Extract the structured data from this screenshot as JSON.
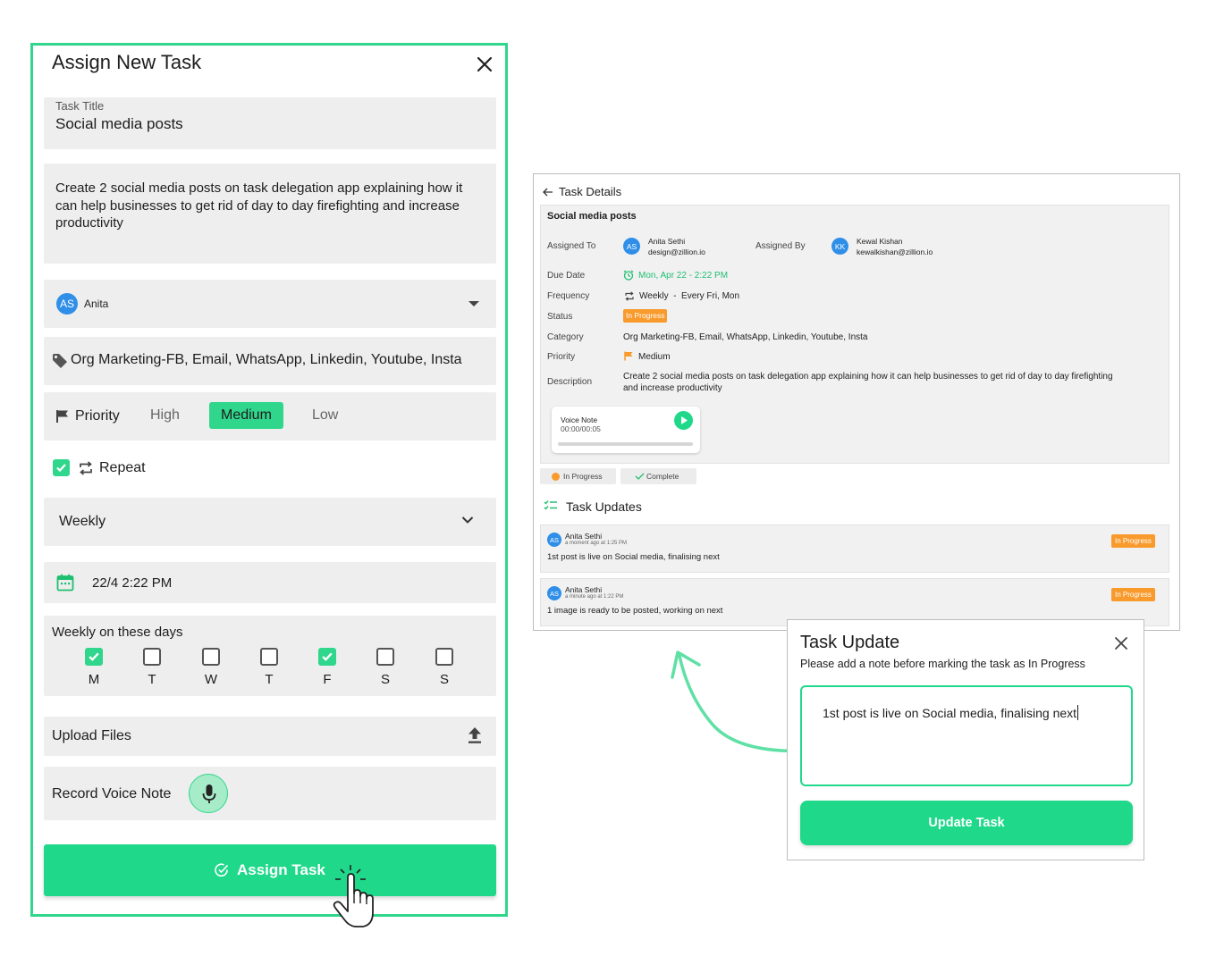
{
  "assign": {
    "title": "Assign New Task",
    "task_title_label": "Task Title",
    "task_title_value": "Social media posts",
    "description": "Create 2 social media posts on task delegation app explaining how it can help businesses to get rid of day to day firefighting and increase productivity",
    "assignee": {
      "initials": "AS",
      "name": "Anita"
    },
    "category": "Org Marketing-FB, Email, WhatsApp, Linkedin, Youtube, Insta",
    "priority": {
      "label": "Priority",
      "options": [
        "High",
        "Medium",
        "Low"
      ],
      "selected": "Medium"
    },
    "repeat": {
      "label": "Repeat",
      "checked": true
    },
    "frequency": "Weekly",
    "due_date": "22/4 2:22 PM",
    "weekdays": {
      "label": "Weekly on these days",
      "days": [
        {
          "letter": "M",
          "checked": true
        },
        {
          "letter": "T",
          "checked": false
        },
        {
          "letter": "W",
          "checked": false
        },
        {
          "letter": "T",
          "checked": false
        },
        {
          "letter": "F",
          "checked": true
        },
        {
          "letter": "S",
          "checked": false
        },
        {
          "letter": "S",
          "checked": false
        }
      ]
    },
    "upload_label": "Upload Files",
    "voice_label": "Record Voice Note",
    "submit_label": "Assign Task"
  },
  "details": {
    "title": "Task Details",
    "task_name": "Social media posts",
    "assigned_to_label": "Assigned To",
    "assigned_to": {
      "initials": "AS",
      "name": "Anita Sethi",
      "email": "design@zillion.io"
    },
    "assigned_by_label": "Assigned By",
    "assigned_by": {
      "initials": "KK",
      "name": "Kewal Kishan",
      "email": "kewalkishan@zillion.io"
    },
    "due_date_label": "Due Date",
    "due_date": "Mon, Apr 22 - 2:22 PM",
    "frequency_label": "Frequency",
    "frequency": "Weekly  -  Every Fri, Mon",
    "status_label": "Status",
    "status": "In Progress",
    "category_label": "Category",
    "category": "Org Marketing-FB, Email, WhatsApp, Linkedin, Youtube, Insta",
    "priority_label": "Priority",
    "priority": "Medium",
    "description_label": "Description",
    "description_line1": "Create 2 social media posts on task delegation app explaining how it can help businesses to get rid of day to day firefighting",
    "description_line2": "and increase productivity",
    "voice_note": {
      "label": "Voice Note",
      "time": "00:00/00:05",
      "progress": 0
    },
    "actions": {
      "in_progress": "In Progress",
      "complete": "Complete"
    },
    "updates_title": "Task Updates",
    "updates": [
      {
        "initials": "AS",
        "name": "Anita Sethi",
        "time": "a moment ago at 1:25 PM",
        "text": "1st post is live on Social media, finalising next",
        "status": "In Progress"
      },
      {
        "initials": "AS",
        "name": "Anita Sethi",
        "time": "a minute ago at 1:22 PM",
        "text": "1 image is ready to be posted, working on next",
        "status": "In Progress"
      }
    ]
  },
  "update_dialog": {
    "title": "Task Update",
    "subtitle": "Please add a note before marking the task as In Progress",
    "note_value": "1st post is live on Social media, finalising next",
    "button_label": "Update Task"
  },
  "colors": {
    "accent": "#1fd88a",
    "border_accent": "#2fd68b",
    "status": "#f89a2c",
    "avatar": "#2f8fe8",
    "field_bg": "#eeeeee"
  },
  "icons": [
    "close-icon",
    "tag-icon",
    "flag-icon",
    "repeat-icon",
    "chevron-down-icon",
    "calendar-icon",
    "upload-icon",
    "mic-icon",
    "check-circle-icon",
    "hand-pointer-icon",
    "back-arrow-icon",
    "alarm-icon",
    "play-icon",
    "checklist-icon"
  ]
}
